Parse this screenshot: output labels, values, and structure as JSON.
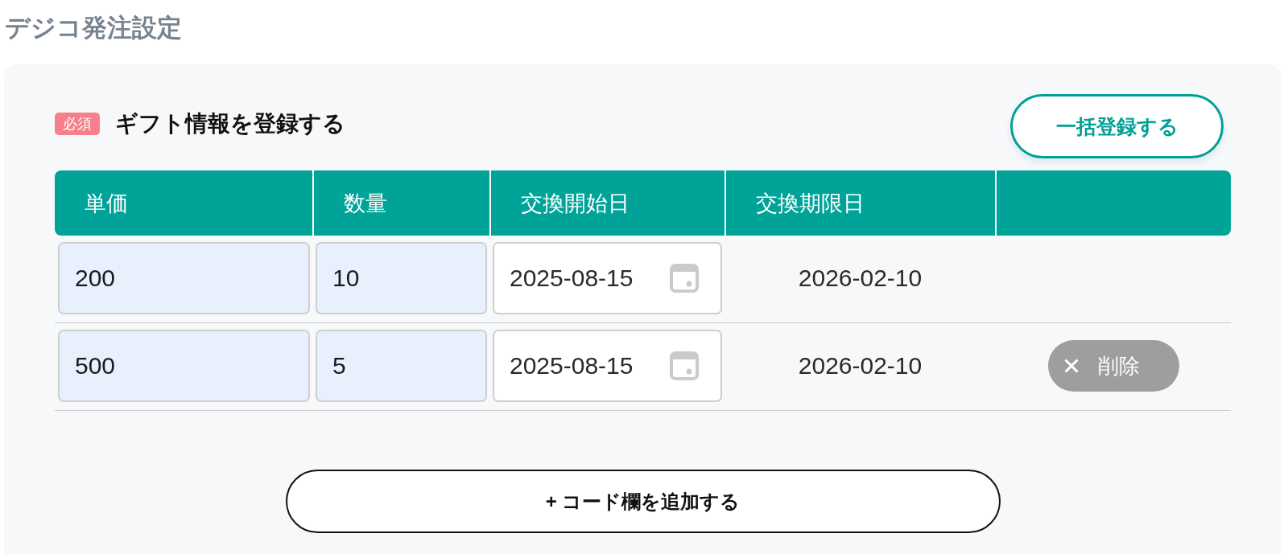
{
  "page_title": "デジコ発注設定",
  "gift_section": {
    "required_badge": "必須",
    "title": "ギフト情報を登録する",
    "bulk_register_button": "一括登録する"
  },
  "table": {
    "columns": [
      "単価",
      "数量",
      "交換開始日",
      "交換期限日"
    ],
    "rows": [
      {
        "unit_price": "200",
        "quantity": "10",
        "start_date": "2025-08-15",
        "end_date": "2026-02-10"
      },
      {
        "unit_price": "500",
        "quantity": "5",
        "start_date": "2025-08-15",
        "end_date": "2026-02-10",
        "delete_button": "削除"
      }
    ]
  },
  "add_code_button": "+ コード欄を追加する"
}
